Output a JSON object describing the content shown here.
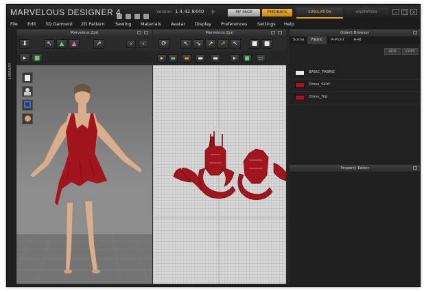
{
  "app": {
    "title": "MARVELOUS DESIGNER 4",
    "version_label": "Version",
    "version": "1.4.42.8440",
    "my_page_label": "MY PAGE",
    "feedback_label": "FEEDBACK",
    "mode_simulation": "SIMULATION",
    "mode_animation": "ANIMATION",
    "colors": {
      "accent": "#e3a125",
      "garment": "#a3151e",
      "panel_bg": "#222222"
    }
  },
  "menu": [
    "File",
    "Edit",
    "3D Garment",
    "2D Pattern",
    "Sewing",
    "Materials",
    "Avatar",
    "Display",
    "Preferences",
    "Settings",
    "Help"
  ],
  "library": {
    "label": "LIBRARY"
  },
  "view3d": {
    "title": "Marvelous.Zprj"
  },
  "view2d": {
    "title": "Marvelous.Zprj"
  },
  "object_browser": {
    "title": "Object Browser",
    "tabs": [
      "Scene",
      "Fabric",
      "A-Point",
      "A-RI"
    ],
    "active_tab": "Fabric",
    "add_label": "ADD",
    "copy_label": "COPY",
    "fabrics": [
      {
        "name": "BASIC_FABRIC",
        "color": "#e6e6e6"
      },
      {
        "name": "Dress_Skirt",
        "color": "#a3151e"
      },
      {
        "name": "Dress_Top",
        "color": "#a3151e"
      }
    ]
  },
  "property_editor": {
    "title": "Property Editor"
  }
}
